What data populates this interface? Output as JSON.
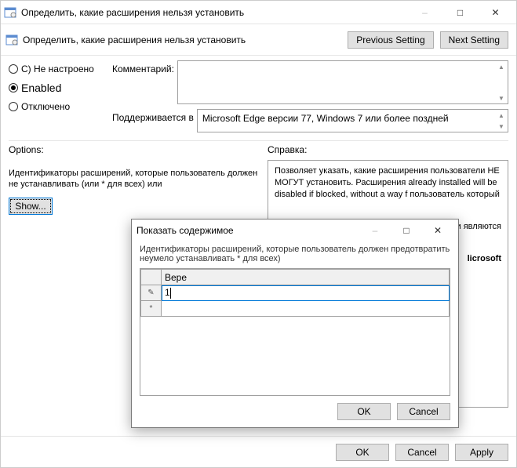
{
  "window": {
    "title": "Определить, какие расширения нельзя установить",
    "minimize": "–",
    "maximize": "□",
    "close": "✕"
  },
  "header": {
    "subtitle": "Определить, какие расширения нельзя установить",
    "prev": "Previous Setting",
    "next": "Next Setting"
  },
  "radios": {
    "not_configured": "C) Не настроено",
    "enabled": "Enabled",
    "disabled": "Отключено"
  },
  "fields": {
    "comment_label": "Комментарий:",
    "supported_label": "Поддерживается в",
    "supported_value": "Microsoft Edge версии 77, Windows 7 или более поздней"
  },
  "options": {
    "label": "Options:",
    "description": "Идентификаторы расширений, которые пользователь должен не устанавливать (или * для всех) или",
    "show": "Show..."
  },
  "help": {
    "label": "Справка:",
    "p1": "Позволяет указать, какие расширения пользователи НЕ МОГУТ установить. Расширения already installed will be disabled if blocked, without a way f пользователь который",
    "p2": "ess они являются",
    "p3": "licrosoft"
  },
  "footer": {
    "ok": "OK",
    "cancel": "Cancel",
    "apply": "Apply"
  },
  "dialog": {
    "title": "Показать содержимое",
    "description": "Идентификаторы расширений, которые пользователь должен предотвратить неумело устанавливать * для всех)",
    "col_header": "Вере",
    "row1_marker": "✎",
    "row1_value": "1",
    "row2_marker": "*",
    "ok": "OK",
    "cancel": "Cancel",
    "minimize": "–",
    "maximize": "□",
    "close": "✕"
  }
}
